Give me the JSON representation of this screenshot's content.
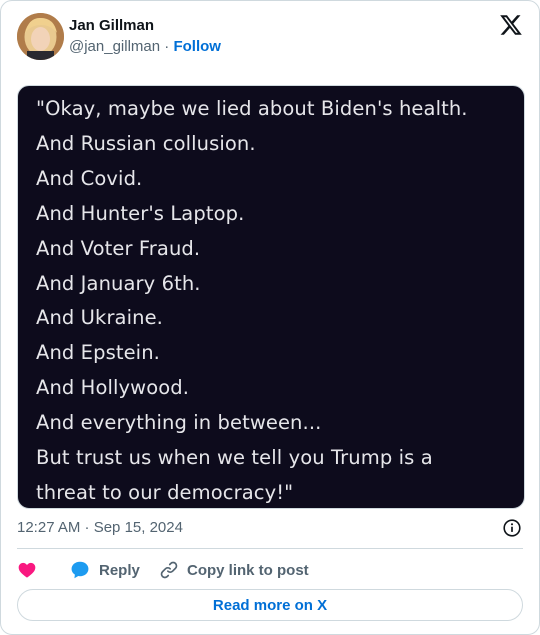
{
  "author": {
    "name": "Jan Gillman",
    "handle": "@jan_gillman",
    "separator": " · ",
    "follow_label": "Follow"
  },
  "icons": {
    "logo": "x-logo-icon",
    "info": "info-icon",
    "like": "heart-icon",
    "reply": "speech-bubble-icon",
    "copy": "link-icon"
  },
  "colors": {
    "like": "#f91880",
    "reply": "#1d9bf0",
    "link": "#006fd6",
    "media_bg": "#0d0b1c"
  },
  "media": {
    "lines": [
      "\"Okay, maybe we lied about Biden's health.",
      "And Russian collusion.",
      "And Covid.",
      "And Hunter's Laptop.",
      "And Voter Fraud.",
      "And January 6th.",
      "And Ukraine.",
      "And Epstein.",
      "And Hollywood.",
      "And everything in between...",
      "But trust us when we tell you Trump is a",
      "threat to our democracy!\""
    ]
  },
  "meta": {
    "timestamp": "12:27 AM · Sep 15, 2024"
  },
  "actions": {
    "reply_label": "Reply",
    "copy_label": "Copy link to post"
  },
  "footer": {
    "read_more_label": "Read more on X"
  }
}
